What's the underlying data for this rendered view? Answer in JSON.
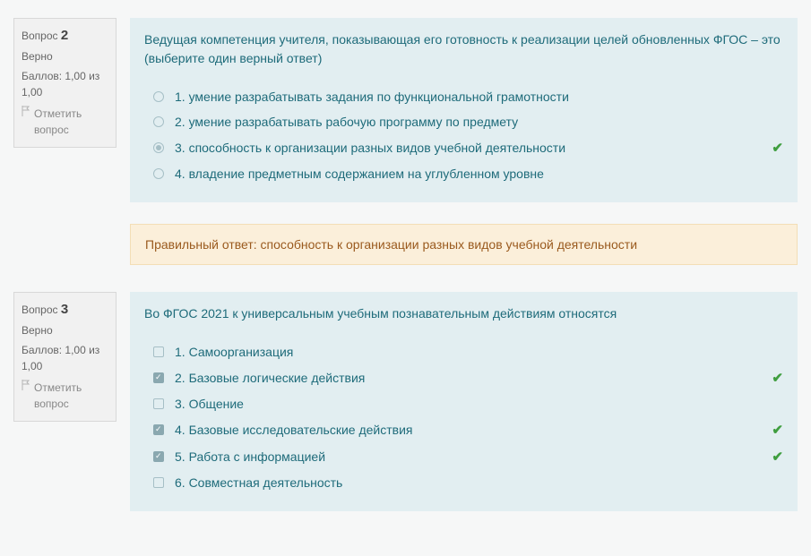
{
  "questions": [
    {
      "label": "Вопрос",
      "number": "2",
      "status": "Верно",
      "marks_line": "Баллов: 1,00 из 1,00",
      "flag_text": "Отметить вопрос",
      "text": "Ведущая компетенция учителя, показывающая его готовность к реализации целей обновленных ФГОС – это (выберите один верный ответ)",
      "type": "radio",
      "options": [
        {
          "label": "1. умение разрабатывать задания по функциональной грамотности",
          "selected": false,
          "correct": false
        },
        {
          "label": "2. умение разрабатывать рабочую программу по предмету",
          "selected": false,
          "correct": false
        },
        {
          "label": "3. способность к организации разных видов учебной деятельности",
          "selected": true,
          "correct": true
        },
        {
          "label": "4. владение предметным содержанием на углубленном уровне",
          "selected": false,
          "correct": false
        }
      ],
      "feedback": "Правильный ответ: способность к организации разных видов учебной деятельности"
    },
    {
      "label": "Вопрос",
      "number": "3",
      "status": "Верно",
      "marks_line": "Баллов: 1,00 из 1,00",
      "flag_text": "Отметить вопрос",
      "text": "Во ФГОС 2021 к универсальным учебным познавательным действиям относятся",
      "type": "checkbox",
      "options": [
        {
          "label": "1. Самоорганизация",
          "selected": false,
          "correct": false
        },
        {
          "label": "2. Базовые логические действия",
          "selected": true,
          "correct": true
        },
        {
          "label": "3. Общение",
          "selected": false,
          "correct": false
        },
        {
          "label": "4. Базовые исследовательские действия",
          "selected": true,
          "correct": true
        },
        {
          "label": "5. Работа с информацией",
          "selected": true,
          "correct": true
        },
        {
          "label": "6. Совместная деятельность",
          "selected": false,
          "correct": false
        }
      ],
      "feedback": null
    }
  ]
}
